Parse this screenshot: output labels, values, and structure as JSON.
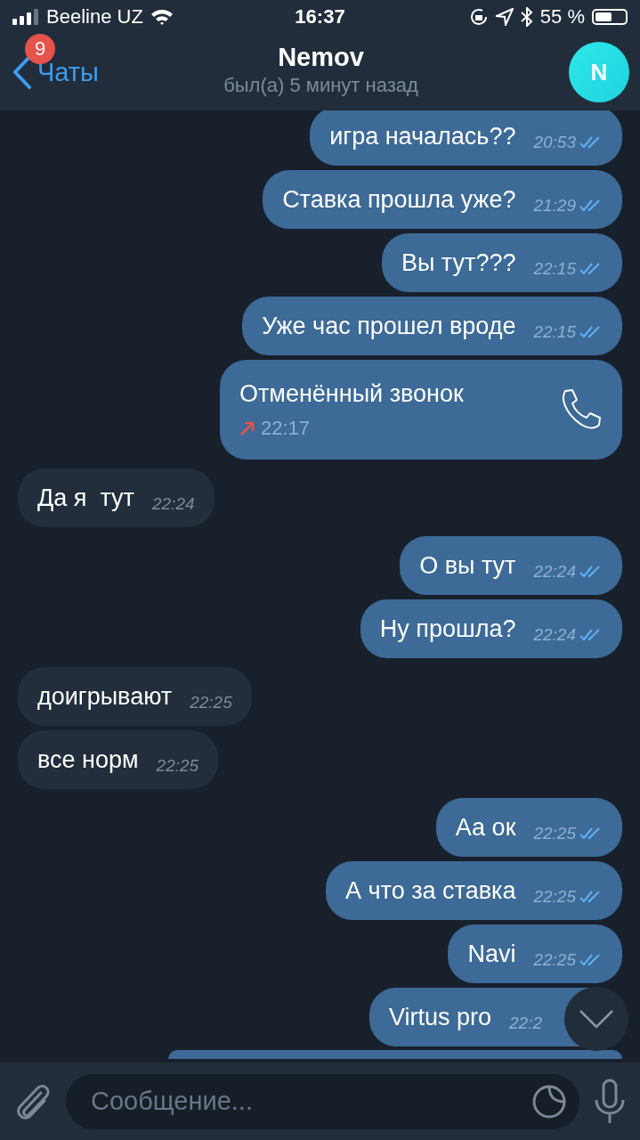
{
  "status_bar": {
    "carrier": "Beeline UZ",
    "time": "16:37",
    "battery": "55 %"
  },
  "header": {
    "back_label": "Чаты",
    "unread_badge": "9",
    "title": "Nemov",
    "subtitle": "был(а) 5 минут назад",
    "avatar_letter": "N"
  },
  "messages": [
    {
      "kind": "text",
      "outgoing": true,
      "text": "игра началась??",
      "time": "20:53",
      "read": true
    },
    {
      "kind": "text",
      "outgoing": true,
      "text": "Ставка прошла уже?",
      "time": "21:29",
      "read": true
    },
    {
      "kind": "text",
      "outgoing": true,
      "text": "Вы тут???",
      "time": "22:15",
      "read": true
    },
    {
      "kind": "text",
      "outgoing": true,
      "text": "Уже час прошел вроде",
      "time": "22:15",
      "read": true
    },
    {
      "kind": "call",
      "outgoing": true,
      "text": "Отменённый звонок",
      "time": "22:17"
    },
    {
      "kind": "text",
      "outgoing": false,
      "text": "Да я  тут",
      "time": "22:24"
    },
    {
      "kind": "text",
      "outgoing": true,
      "text": "О вы тут",
      "time": "22:24",
      "read": true
    },
    {
      "kind": "text",
      "outgoing": true,
      "text": "Ну прошла?",
      "time": "22:24",
      "read": true
    },
    {
      "kind": "text",
      "outgoing": false,
      "text": "доигрывают",
      "time": "22:25"
    },
    {
      "kind": "text",
      "outgoing": false,
      "text": "все норм",
      "time": "22:25"
    },
    {
      "kind": "text",
      "outgoing": true,
      "text": "Аа ок",
      "time": "22:25",
      "read": true
    },
    {
      "kind": "text",
      "outgoing": true,
      "text": "А что за ставка",
      "time": "22:25",
      "read": true
    },
    {
      "kind": "text",
      "outgoing": true,
      "text": "Navi",
      "time": "22:25",
      "read": true
    },
    {
      "kind": "text",
      "outgoing": true,
      "text": "Virtus pro",
      "time": "22:2"
    },
    {
      "kind": "partial",
      "outgoing": true
    }
  ],
  "composer": {
    "placeholder": "Сообщение..."
  }
}
